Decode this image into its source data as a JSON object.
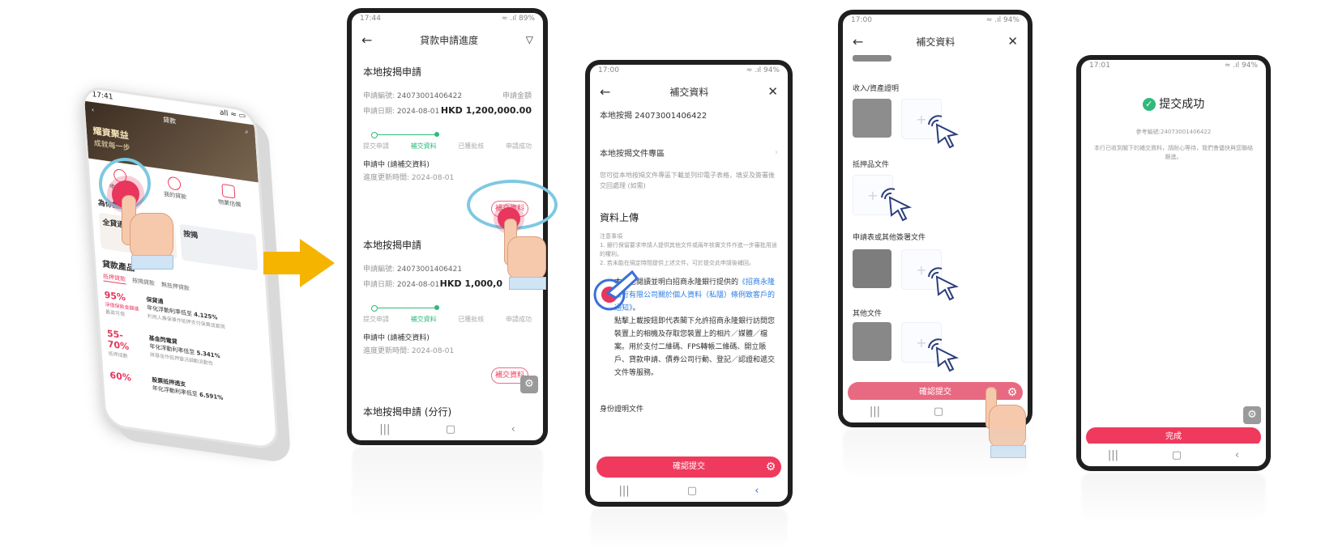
{
  "colors": {
    "accent": "#ef3a5d",
    "success": "#2fb97a",
    "arrow": "#f5b400",
    "link": "#2a7de1"
  },
  "phone1": {
    "status_time": "17:41",
    "status_right": "all ≈ ▭",
    "header_title": "貸款",
    "banner_text1": "耀資聚益",
    "banner_text2": "成就每一步",
    "quick_items": [
      "申請進度",
      "我的貸款",
      "物業估價"
    ],
    "section_recommend": "為你推薦",
    "rec1": "全貸通",
    "rec2": "按揭",
    "products_title": "貸款產品",
    "tabs": [
      "抵押貸款",
      "按揭貸款",
      "無抵押貸款"
    ],
    "rows": [
      {
        "pct": "95%",
        "pct_sub": "淨值保險金額進",
        "pct_sub2": "最高可借",
        "name": "保貸通",
        "desc": "年化浮動利率低至",
        "rate": "4.125%",
        "desc2": "利用人壽保單作抵押支付保費或套現"
      },
      {
        "pct": "55-70%",
        "pct_sub": "抵押成數",
        "name": "基金閃電貸",
        "desc": "年化浮動利率低至",
        "rate": "5.341%",
        "desc2": "將基金作抵押靈活調動流動性"
      },
      {
        "pct": "60%",
        "pct_sub": "",
        "name": "股票抵押透支",
        "desc": "年化浮動利率低至",
        "rate": "6.591%",
        "desc2": ""
      }
    ]
  },
  "phone2": {
    "status_time": "17:44",
    "status_right": "≈ .ıl 89%",
    "title": "貸款申請進度",
    "apps": [
      {
        "name": "本地按揭申請",
        "no_label": "申請編號:",
        "no": "24073001406422",
        "amount_label": "申請金額",
        "date_label": "申請日期:",
        "date": "2024-08-01",
        "amount": "HKD 1,200,000.00",
        "status": "申請中 (請補交資料)",
        "updated": "進度更新時間: 2024-08-01",
        "btn": "補交資料"
      },
      {
        "name": "本地按揭申請",
        "no_label": "申請編號:",
        "no": "24073001406421",
        "amount_label": "",
        "date_label": "申請日期:",
        "date": "2024-08-01",
        "amount": "HKD 1,000,0",
        "status": "申請中 (請補交資料)",
        "updated": "進度更新時間: 2024-08-01",
        "btn": "補交資料"
      }
    ],
    "steps": [
      "提交申請",
      "補交資料",
      "已獲批核",
      "申請成功"
    ],
    "third": "本地按揭申請 (分行)"
  },
  "phone3": {
    "status_time": "17:00",
    "status_right": "≈ .ıl 94%",
    "title": "補交資料",
    "ref": "本地按揭 24073001406422",
    "doc_area": "本地按揭文件專區",
    "doc_desc": "您可從本地按揭文件專區下載並列印電子表格，填妥及簽署後交回處理 (如需)",
    "upload_title": "資料上傳",
    "notes_title": "注意事項",
    "note1": "1. 銀行保留要求申請人提供其他文件或兩年核實文件作進一步審批用途的權利。",
    "note2": "2. 若未能在規定時間提供上述文件，可於提交此申請後補回。",
    "consent_pre": "本人已閱讀並明白招商永隆銀行提供的",
    "consent_link": "《招商永隆銀行有限公司關於個人資料（私隱）條例致客戶的通知》",
    "consent_post": "。",
    "consent_body": "點擊上載按鈕即代表閣下允許招商永隆銀行訪問您裝置上的相機及存取您裝置上的相片／媒體／檔案。用於支付二維碼、FPS轉帳二維碼、開立賬戶、貸款申請、債券公司行動、登記／認證和遞交文件等服務。",
    "id_doc": "身份證明文件",
    "submit": "確認提交"
  },
  "phone4": {
    "status_time": "17:00",
    "status_right": "≈ .ıl 94%",
    "title": "補交資料",
    "sections": [
      "收入/資產證明",
      "抵押品文件",
      "申請表或其他簽署文件",
      "其他文件"
    ],
    "submit": "確認提交"
  },
  "phone5": {
    "status_time": "17:01",
    "status_right": "≈ .ıl 94%",
    "success_title": "提交成功",
    "ref": "參考編號:24073001406422",
    "message": "本行已收到閣下的補交資料，請耐心等待，我們會儘快與您聯絡跟進。",
    "done": "完成"
  },
  "icons": [
    "back-arrow-icon",
    "filter-icon",
    "close-icon",
    "gear-icon",
    "check-icon",
    "arrow-right-icon",
    "pointer-hand-icon",
    "click-cursor-icon"
  ]
}
